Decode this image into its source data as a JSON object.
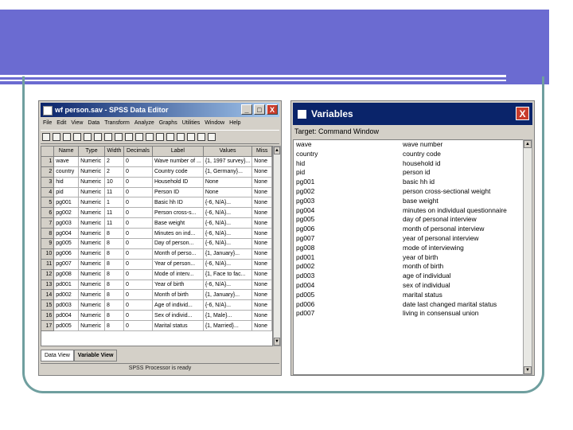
{
  "spss": {
    "title": "wf person.sav - SPSS Data Editor",
    "controls": {
      "minimize": "_",
      "maximize": "□",
      "close": "X"
    },
    "menu": [
      "File",
      "Edit",
      "View",
      "Data",
      "Transform",
      "Analyze",
      "Graphs",
      "Utilities",
      "Window",
      "Help"
    ],
    "toolbar_icons": [
      "open-icon",
      "save-icon",
      "print-icon",
      "dialog-recall-icon",
      "undo-icon",
      "redo-icon",
      "goto-chart-icon",
      "goto-case-icon",
      "variables-icon",
      "find-icon",
      "insert-case-icon",
      "insert-variable-icon",
      "split-file-icon",
      "weight-cases-icon",
      "select-cases-icon",
      "value-labels-icon",
      "use-sets-icon"
    ],
    "columns": [
      "",
      "Name",
      "Type",
      "Width",
      "Decimals",
      "Label",
      "Values",
      "Miss"
    ],
    "rows": [
      {
        "n": "1",
        "name": "wave",
        "type": "Numeric",
        "width": "2",
        "dec": "0",
        "label": "Wave number of ...",
        "values": "{1, 1997 survey}...",
        "miss": "None"
      },
      {
        "n": "2",
        "name": "country",
        "type": "Numeric",
        "width": "2",
        "dec": "0",
        "label": "Country code",
        "values": "{1, Germany}...",
        "miss": "None"
      },
      {
        "n": "3",
        "name": "hid",
        "type": "Numeric",
        "width": "10",
        "dec": "0",
        "label": "Household ID",
        "values": "None",
        "miss": "None"
      },
      {
        "n": "4",
        "name": "pid",
        "type": "Numeric",
        "width": "11",
        "dec": "0",
        "label": "Person ID",
        "values": "None",
        "miss": "None"
      },
      {
        "n": "5",
        "name": "pg001",
        "type": "Numeric",
        "width": "1",
        "dec": "0",
        "label": "Basic hh ID",
        "values": "{-6, N/A}...",
        "miss": "None"
      },
      {
        "n": "6",
        "name": "pg002",
        "type": "Numeric",
        "width": "11",
        "dec": "0",
        "label": "Person cross-s...",
        "values": "{-6, N/A}...",
        "miss": "None"
      },
      {
        "n": "7",
        "name": "pg003",
        "type": "Numeric",
        "width": "11",
        "dec": "0",
        "label": "Base weight",
        "values": "{-6, N/A}...",
        "miss": "None"
      },
      {
        "n": "8",
        "name": "pg004",
        "type": "Numeric",
        "width": "8",
        "dec": "0",
        "label": "Minutes on ind...",
        "values": "{-6, N/A}...",
        "miss": "None"
      },
      {
        "n": "9",
        "name": "pg005",
        "type": "Numeric",
        "width": "8",
        "dec": "0",
        "label": "Day of person...",
        "values": "{-6, N/A}...",
        "miss": "None"
      },
      {
        "n": "10",
        "name": "pg006",
        "type": "Numeric",
        "width": "8",
        "dec": "0",
        "label": "Month of perso...",
        "values": "{1, January}...",
        "miss": "None"
      },
      {
        "n": "11",
        "name": "pg007",
        "type": "Numeric",
        "width": "8",
        "dec": "0",
        "label": "Year of person...",
        "values": "{-6, N/A}...",
        "miss": "None"
      },
      {
        "n": "12",
        "name": "pg008",
        "type": "Numeric",
        "width": "8",
        "dec": "0",
        "label": "Mode of interv...",
        "values": "{1, Face to fac...",
        "miss": "None"
      },
      {
        "n": "13",
        "name": "pd001",
        "type": "Numeric",
        "width": "8",
        "dec": "0",
        "label": "Year of birth",
        "values": "{-6, N/A}...",
        "miss": "None"
      },
      {
        "n": "14",
        "name": "pd002",
        "type": "Numeric",
        "width": "8",
        "dec": "0",
        "label": "Month of birth",
        "values": "{1, January}...",
        "miss": "None"
      },
      {
        "n": "15",
        "name": "pd003",
        "type": "Numeric",
        "width": "8",
        "dec": "0",
        "label": "Age of individ...",
        "values": "{-6, N/A}...",
        "miss": "None"
      },
      {
        "n": "16",
        "name": "pd004",
        "type": "Numeric",
        "width": "8",
        "dec": "0",
        "label": "Sex of individ...",
        "values": "{1, Male}...",
        "miss": "None"
      },
      {
        "n": "17",
        "name": "pd005",
        "type": "Numeric",
        "width": "8",
        "dec": "0",
        "label": "Marital status",
        "values": "{1, Married}...",
        "miss": "None"
      }
    ],
    "tabs": [
      "Data View",
      "Variable View"
    ],
    "status": "SPSS Processor is ready"
  },
  "variables": {
    "title": "Variables",
    "close": "X",
    "target": "Target: Command Window",
    "items": [
      {
        "name": "wave",
        "label": "wave number"
      },
      {
        "name": "country",
        "label": "country code"
      },
      {
        "name": "hid",
        "label": "household id"
      },
      {
        "name": "pid",
        "label": "person id"
      },
      {
        "name": "pg001",
        "label": "basic hh id"
      },
      {
        "name": "pg002",
        "label": "person cross-sectional weight"
      },
      {
        "name": "pg003",
        "label": "base weight"
      },
      {
        "name": "pg004",
        "label": "minutes on individual questionnaire"
      },
      {
        "name": "pg005",
        "label": "day of personal interview"
      },
      {
        "name": "pg006",
        "label": "month of personal interview"
      },
      {
        "name": "pg007",
        "label": "year of personal interview"
      },
      {
        "name": "pg008",
        "label": "mode of interviewing"
      },
      {
        "name": "pd001",
        "label": "year of birth"
      },
      {
        "name": "pd002",
        "label": "month of birth"
      },
      {
        "name": "pd003",
        "label": "age of individual"
      },
      {
        "name": "pd004",
        "label": "sex of individual"
      },
      {
        "name": "pd005",
        "label": "marital status"
      },
      {
        "name": "pd006",
        "label": "date last changed marital status"
      },
      {
        "name": "pd007",
        "label": "living in consensual union"
      }
    ]
  },
  "colors": {
    "banner": "#6b6bd1",
    "frame": "#6f9f9f",
    "titlebar": "#0a246a",
    "close": "#c83c2c"
  }
}
